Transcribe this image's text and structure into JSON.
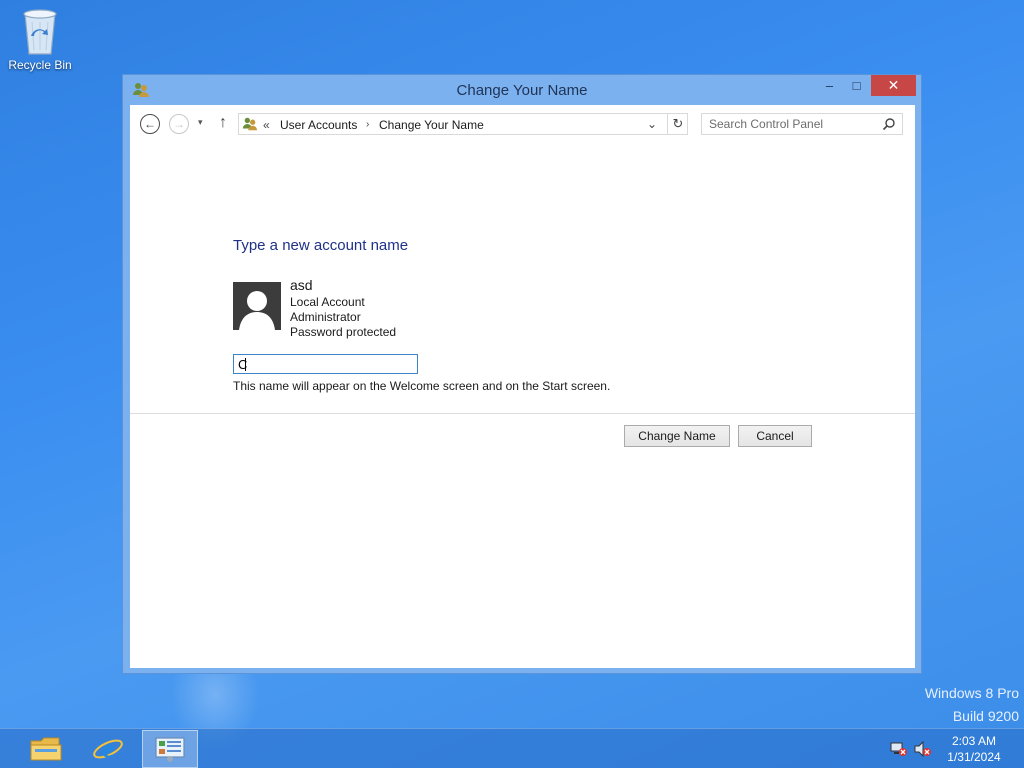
{
  "desktop": {
    "icons": [
      {
        "label": "Recycle Bin",
        "icon": "recycle-bin-icon"
      }
    ],
    "watermark": {
      "line1": "Windows 8 Pro",
      "line2": "Build 9200"
    }
  },
  "window": {
    "title": "Change Your Name",
    "controls": {
      "minimize": "–",
      "maximize": "□",
      "close": "✕"
    },
    "navigation": {
      "back": "←",
      "forward": "→",
      "recent": "▾",
      "up": "↑",
      "breadcrumb_prefix": "«",
      "breadcrumb": [
        "User Accounts",
        "Change Your Name"
      ],
      "breadcrumb_separator": "›",
      "dropdown": "⌄",
      "refresh": "↻"
    },
    "search": {
      "placeholder": "Search Control Panel"
    },
    "main": {
      "heading": "Type a new account name",
      "account": {
        "name": "asd",
        "type": "Local Account",
        "role": "Administrator",
        "password_status": "Password protected"
      },
      "new_name_input": {
        "value": "C"
      },
      "hint": "This name will appear on the Welcome screen and on the Start screen.",
      "buttons": {
        "change": "Change Name",
        "cancel": "Cancel"
      }
    }
  },
  "taskbar": {
    "items": [
      "file-explorer-icon",
      "internet-explorer-icon",
      "control-panel-icon"
    ],
    "tray": {
      "time": "2:03 AM",
      "date": "1/31/2024",
      "icons": [
        "network-disconnected-icon",
        "volume-muted-icon"
      ]
    }
  },
  "colors": {
    "desktop_bg": "#3a8ef0",
    "window_frame": "#7cb1f0",
    "close_button": "#c74646",
    "heading_text": "#1e3287",
    "input_border": "#3c84c8"
  }
}
